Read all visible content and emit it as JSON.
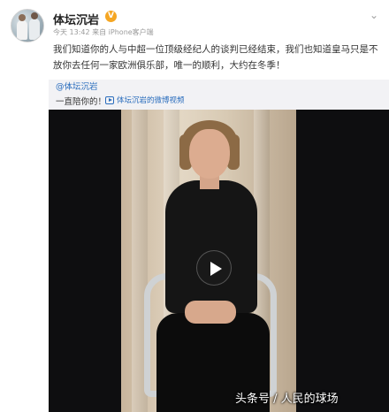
{
  "post": {
    "username": "体坛沉岩",
    "verified_mark": "V",
    "meta": "今天 13:42 来自 iPhone客户端",
    "menu_icon": "chevron-down-icon",
    "text": "我们知道你的人与中超一位顶级经纪人的谈判已经结束，我们也知道皇马只是不放你去任何一家欧洲俱乐部，唯一的顺利，大约在冬季！"
  },
  "repost": {
    "author": "@体坛沉岩",
    "text": "一直陪你的！",
    "link_label": "体坛沉岩的微博视频"
  },
  "video": {
    "play_icon": "play-icon"
  },
  "watermark": "头条号 / 人民的球场"
}
